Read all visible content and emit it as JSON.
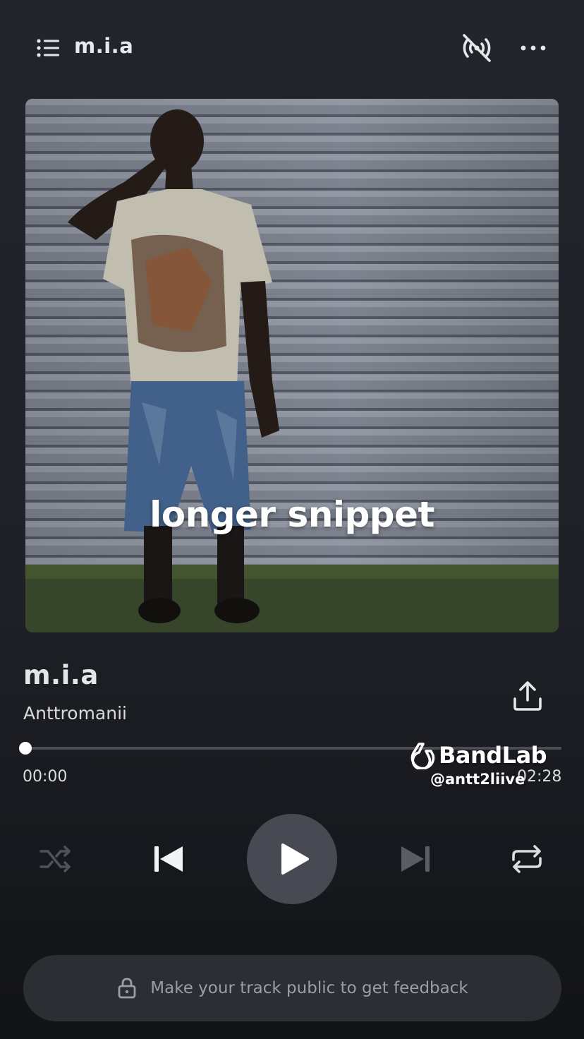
{
  "header": {
    "title": "m.i.a",
    "menu_icon": "list-menu-icon",
    "cast_icon": "broadcast-off-icon",
    "more_icon": "more-horizontal-icon"
  },
  "artwork": {
    "caption": "longer snippet"
  },
  "track": {
    "title": "m.i.a",
    "artist": "Anttromanii",
    "share_icon": "share-upload-icon"
  },
  "playback": {
    "elapsed": "00:00",
    "total": "02:28",
    "progress_fraction": 0.0
  },
  "watermark": {
    "brand": "BandLab",
    "handle": "@antt2liive"
  },
  "controls": {
    "shuffle_icon": "shuffle-icon",
    "previous_icon": "skip-previous-icon",
    "play_icon": "play-icon",
    "next_icon": "skip-next-icon",
    "repeat_icon": "repeat-icon"
  },
  "feedback": {
    "text": "Make your track public to get feedback",
    "icon": "lock-icon"
  },
  "colors": {
    "background": "#23252c",
    "play_button": "#474a52",
    "feedback_bar": "#2c2e34",
    "progress_track": "#4a4d55"
  }
}
